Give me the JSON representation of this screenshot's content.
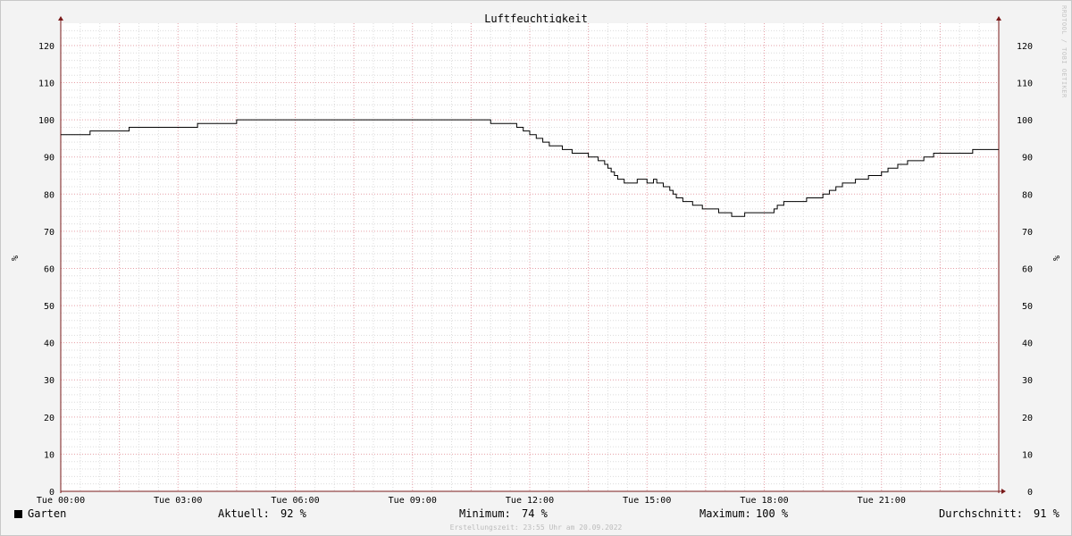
{
  "chart_data": {
    "type": "line",
    "title": "Luftfeuchtigkeit",
    "ylabel": "%",
    "ylabel_right": "%",
    "ylim": [
      0,
      126
    ],
    "y_ticks": [
      0,
      10,
      20,
      30,
      40,
      50,
      60,
      70,
      80,
      90,
      100,
      110,
      120
    ],
    "xlim": [
      "2022-09-20 00:00",
      "2022-09-21 00:00"
    ],
    "x_tick_labels": [
      "Tue 00:00",
      "Tue 03:00",
      "Tue 06:00",
      "Tue 09:00",
      "Tue 12:00",
      "Tue 15:00",
      "Tue 18:00",
      "Tue 21:00"
    ],
    "grid": true,
    "series": [
      {
        "name": "Garten",
        "color": "#000000",
        "x": [
          "00:00",
          "00:45",
          "01:45",
          "03:30",
          "04:30",
          "11:00",
          "11:40",
          "11:50",
          "12:00",
          "12:10",
          "12:20",
          "12:30",
          "12:50",
          "13:05",
          "13:30",
          "13:45",
          "13:55",
          "14:00",
          "14:05",
          "14:10",
          "14:15",
          "14:25",
          "14:45",
          "15:00",
          "15:10",
          "15:15",
          "15:25",
          "15:35",
          "15:40",
          "15:45",
          "15:50",
          "15:55",
          "16:00",
          "16:10",
          "16:25",
          "16:50",
          "17:10",
          "17:20",
          "17:30",
          "17:55",
          "18:15",
          "18:20",
          "18:30",
          "19:05",
          "19:30",
          "19:40",
          "19:50",
          "20:00",
          "20:20",
          "20:40",
          "21:00",
          "21:10",
          "21:25",
          "21:40",
          "21:55",
          "22:05",
          "22:20",
          "22:50",
          "23:20",
          "23:50",
          "24:00"
        ],
        "y": [
          96,
          97,
          98,
          99,
          100,
          99,
          98,
          97,
          96,
          95,
          94,
          93,
          92,
          91,
          90,
          89,
          88,
          87,
          86,
          85,
          84,
          83,
          84,
          83,
          84,
          83,
          82,
          81,
          80,
          79,
          79,
          78,
          78,
          77,
          76,
          75,
          74,
          74,
          75,
          75,
          76,
          77,
          78,
          79,
          80,
          81,
          82,
          83,
          84,
          85,
          86,
          87,
          88,
          89,
          89,
          90,
          91,
          91,
          92,
          92,
          92
        ]
      }
    ]
  },
  "legend": {
    "series_name": "Garten",
    "current_label": "Aktuell:",
    "current_value": "92 %",
    "min_label": "Minimum:",
    "min_value": "74 %",
    "max_label": "Maximum:",
    "max_value": "100 %",
    "avg_label": "Durchschnitt:",
    "avg_value": "91 %"
  },
  "created_text": "Erstellungszeit: 23:55 Uhr am 20.09.2022",
  "watermark": "RRDTOOL / TOBI OETIKER",
  "colors": {
    "background": "#f3f3f3",
    "canvas": "#ffffff",
    "minor_grid": "#dcdcdc",
    "major_grid": "#e6a0a8",
    "axis": "#7a1a1a",
    "line": "#000000"
  }
}
